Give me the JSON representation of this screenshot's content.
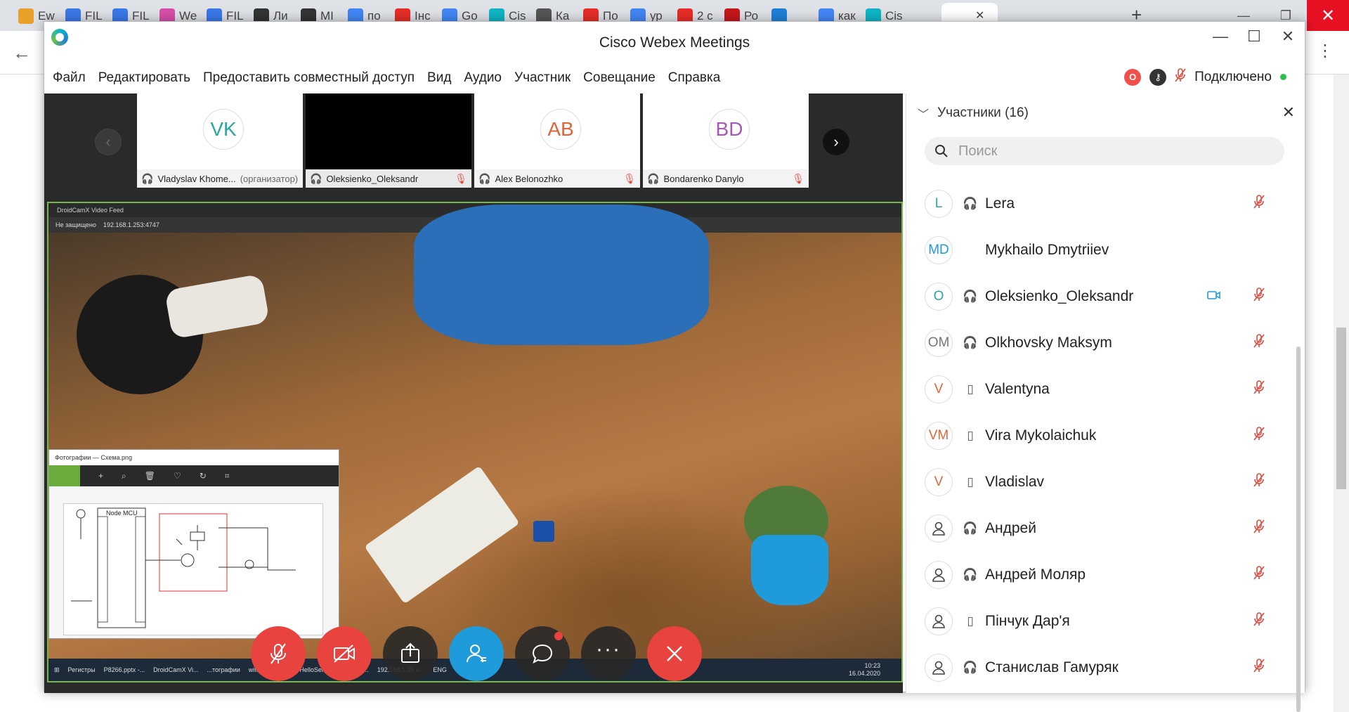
{
  "browser": {
    "tabs": [
      {
        "label": "Ew",
        "color": "#e8a02a"
      },
      {
        "label": "FIL",
        "color": "#3b78e7"
      },
      {
        "label": "FIL",
        "color": "#3b78e7"
      },
      {
        "label": "We",
        "color": "#d64fa8"
      },
      {
        "label": "FIL",
        "color": "#3b78e7"
      },
      {
        "label": "Ли",
        "color": "#333333"
      },
      {
        "label": "МІ",
        "color": "#333333"
      },
      {
        "label": "по",
        "color": "#4285f4"
      },
      {
        "label": "Інс",
        "color": "#e52d27"
      },
      {
        "label": "Go",
        "color": "#4285f4"
      },
      {
        "label": "Cis",
        "color": "#0fb5c4"
      },
      {
        "label": "Ка",
        "color": "#555555"
      },
      {
        "label": "По",
        "color": "#e52d27"
      },
      {
        "label": "ур",
        "color": "#4285f4"
      },
      {
        "label": "2 с",
        "color": "#e52d27"
      },
      {
        "label": "Ро",
        "color": "#c4161c"
      },
      {
        "label": "",
        "color": "#1e7fd6"
      },
      {
        "label": "как",
        "color": "#4285f4"
      },
      {
        "label": "Cis",
        "color": "#0fb5c4"
      }
    ],
    "new_tab": "+",
    "close_tab": "✕"
  },
  "app": {
    "title": "Cisco Webex Meetings",
    "menu": [
      "Файл",
      "Редактировать",
      "Предоставить совместный доступ",
      "Вид",
      "Аудио",
      "Участник",
      "Совещание",
      "Справка"
    ],
    "status_label": "Подключено",
    "status_color": "#2fbf4c"
  },
  "filmstrip": {
    "tiles": [
      {
        "initials": "VK",
        "initials_color": "#2aa6a0",
        "name": "Vladyslav Khome...",
        "role": "(организатор)",
        "muted": false,
        "video": false
      },
      {
        "initials": "",
        "initials_color": "#000000",
        "name": "Oleksienko_Oleksandr",
        "role": "",
        "muted": true,
        "video": true
      },
      {
        "initials": "AB",
        "initials_color": "#e0653a",
        "name": "Alex Belonozhko",
        "role": "",
        "muted": true,
        "video": false
      },
      {
        "initials": "BD",
        "initials_color": "#a45ab8",
        "name": "Bondarenko Danylo",
        "role": "",
        "muted": true,
        "video": false
      }
    ]
  },
  "shared_screen": {
    "browser_tab": "DroidCamX Video Feed",
    "address_security": "Не защищено",
    "address": "192.168.1.253:4747",
    "photos_title": "Фотографии — Схема.png",
    "schematic_label": "Node MCU",
    "taskbar_items": [
      "Регистры",
      "P8266.pptx -...",
      "DroidCamX Vi...",
      "...тографии",
      "wifi.txt - Блок...",
      "HelloServer | Ar...",
      "C:...",
      "192.168.1.25 и..."
    ],
    "taskbar_lang": "ENG",
    "taskbar_time": "10:23",
    "taskbar_date": "16.04.2020"
  },
  "controls": [
    {
      "name": "mute-button",
      "color": "#e8433f"
    },
    {
      "name": "stop-video-button",
      "color": "#e8433f"
    },
    {
      "name": "share-button",
      "color": "#282828"
    },
    {
      "name": "participants-button",
      "color": "#1f9bdb"
    },
    {
      "name": "chat-button",
      "color": "#282828"
    },
    {
      "name": "more-options-button",
      "color": "#282828"
    },
    {
      "name": "leave-meeting-button",
      "color": "#e8433f"
    }
  ],
  "participants_panel": {
    "title": "Участники (16)",
    "search_placeholder": "Поиск",
    "list": [
      {
        "initials": "L",
        "color": "#2aa6a0",
        "device": "headset",
        "name": "Lera",
        "video": false,
        "muted": true
      },
      {
        "initials": "MD",
        "color": "#1f9bdb",
        "device": "",
        "name": "Mykhailo Dmytriiev",
        "video": false,
        "muted": false
      },
      {
        "initials": "O",
        "color": "#2aa6a0",
        "device": "headset",
        "name": "Oleksienko_Oleksandr",
        "video": true,
        "muted": true
      },
      {
        "initials": "OM",
        "color": "#777777",
        "device": "headset",
        "name": "Olkhovsky Maksym",
        "video": false,
        "muted": true
      },
      {
        "initials": "V",
        "color": "#e0653a",
        "device": "phone",
        "name": "Valentyna",
        "video": false,
        "muted": true
      },
      {
        "initials": "VM",
        "color": "#e0653a",
        "device": "phone",
        "name": "Vira Mykolaichuk",
        "video": false,
        "muted": true
      },
      {
        "initials": "V",
        "color": "#e0653a",
        "device": "phone",
        "name": "Vladislav",
        "video": false,
        "muted": true
      },
      {
        "initials": "",
        "color": "#555555",
        "device": "headset",
        "name": "Андрей",
        "video": false,
        "muted": true
      },
      {
        "initials": "",
        "color": "#555555",
        "device": "headset",
        "name": "Андрей Моляр",
        "video": false,
        "muted": true
      },
      {
        "initials": "",
        "color": "#555555",
        "device": "phone",
        "name": "Пінчук Дар'я",
        "video": false,
        "muted": true
      },
      {
        "initials": "",
        "color": "#555555",
        "device": "headset",
        "name": "Станислав Гамуряк",
        "video": false,
        "muted": true
      }
    ]
  }
}
